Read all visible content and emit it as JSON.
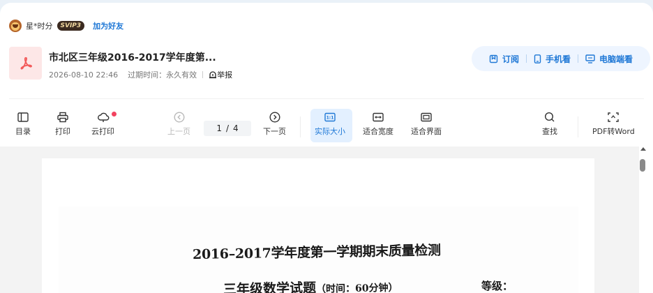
{
  "author": {
    "name": "星*时分",
    "badge": "SVIP3",
    "add_friend": "加为好友"
  },
  "doc": {
    "title": "市北区三年级2016-2017学年度第...",
    "date": "2026-08-10 22:46",
    "expiry": "过期时间：永久有效",
    "report": "举报"
  },
  "actions": [
    {
      "label": "订阅",
      "icon": "bookmark-icon"
    },
    {
      "label": "手机看",
      "icon": "phone-icon"
    },
    {
      "label": "电脑端看",
      "icon": "monitor-icon"
    }
  ],
  "toolbar": {
    "toc": "目录",
    "print": "打印",
    "cloud_print": "云打印",
    "prev": "上一页",
    "current_page": "1",
    "slash": "/",
    "total_pages": "4",
    "next": "下一页",
    "actual_size": "实际大小",
    "fit_width": "适合宽度",
    "fit_page": "适合界面",
    "search": "查找",
    "pdf_to_word": "PDF转Word"
  },
  "document_page": {
    "line1": "2016–2017学年度第一学期期末质量检测",
    "line2_main": "三年级数学试题",
    "line2_small": "（时间：60分钟）",
    "grade": "等级："
  },
  "colors": {
    "accent": "#1f78d6",
    "pdf_red": "#f25a5a",
    "notify_dot": "#f2425f"
  }
}
